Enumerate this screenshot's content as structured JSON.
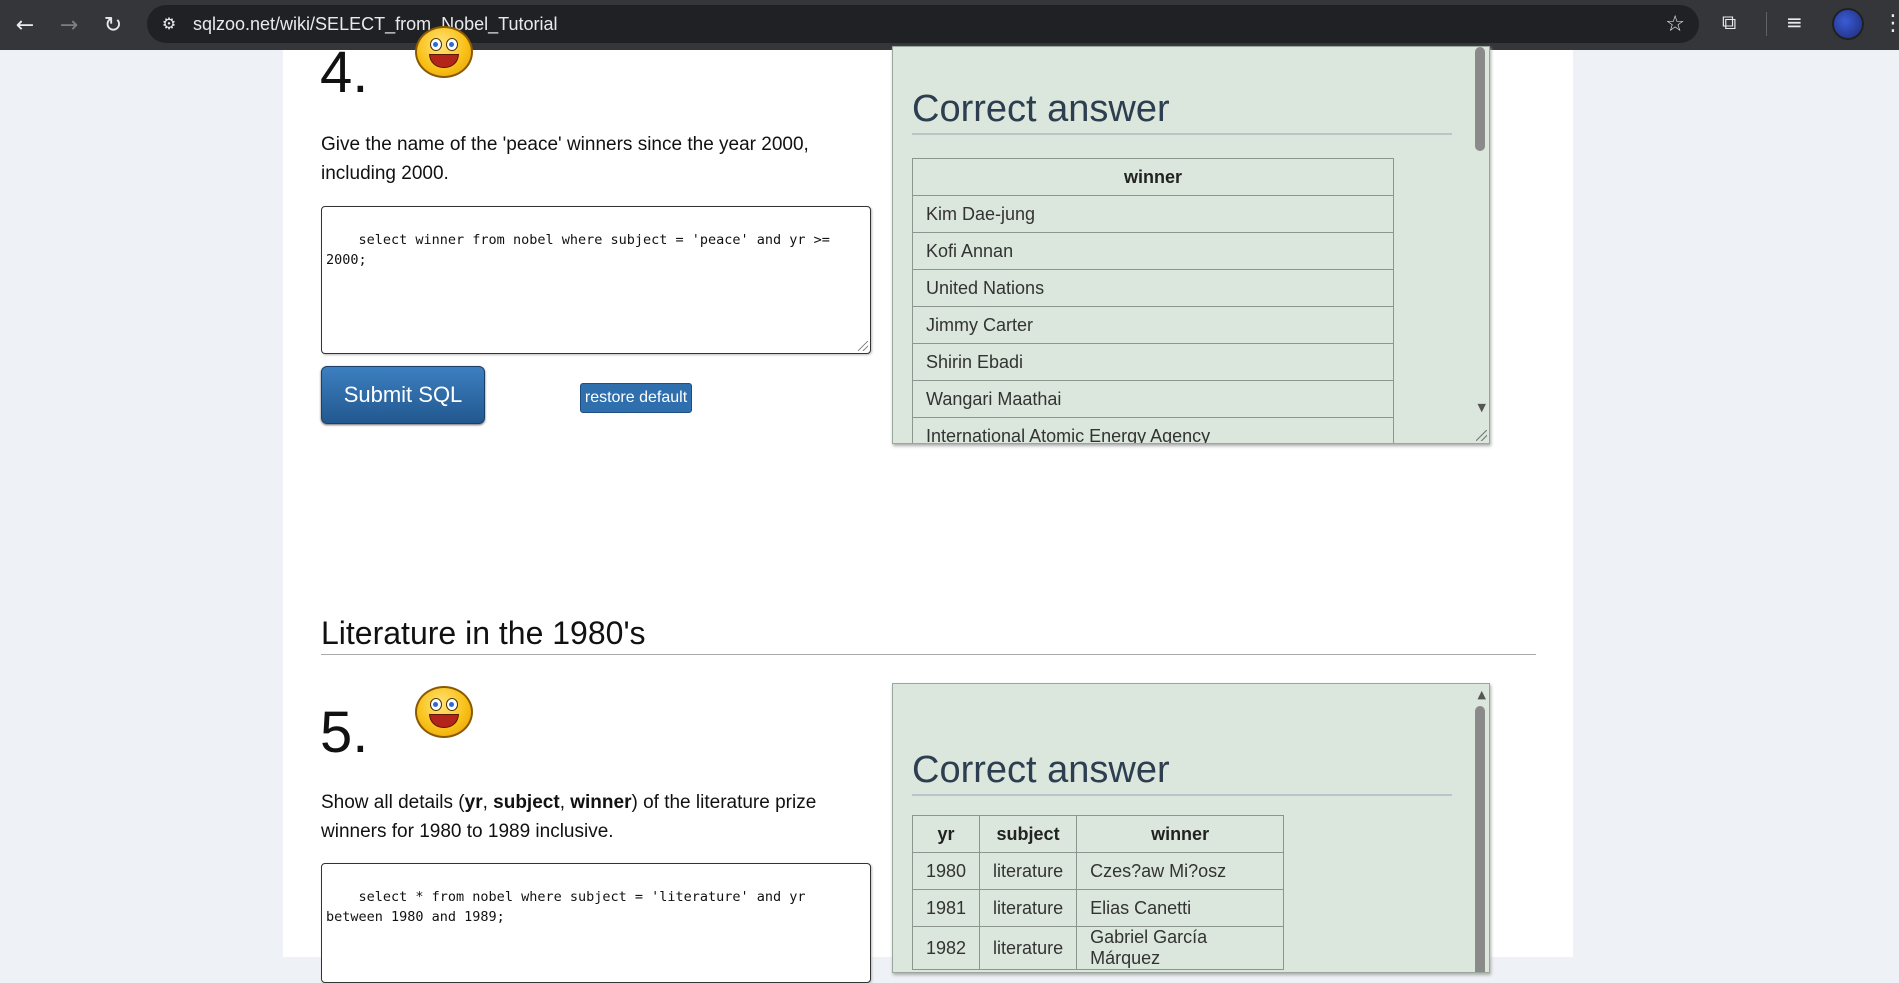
{
  "browser": {
    "url": "sqlzoo.net/wiki/SELECT_from_Nobel_Tutorial"
  },
  "q4": {
    "number": "4.",
    "prompt": "Give the name of the 'peace' winners since the year 2000, including 2000.",
    "sql": "select winner from nobel where subject = 'peace' and yr >= 2000;",
    "submit_label": "Submit SQL",
    "restore_label": "restore default",
    "answer": {
      "title": "Correct answer",
      "header": "winner",
      "rows": [
        "Kim Dae-jung",
        "Kofi Annan",
        "United Nations",
        "Jimmy Carter",
        "Shirin Ebadi",
        "Wangari Maathai",
        "International Atomic Energy Agency"
      ]
    }
  },
  "section": {
    "title": "Literature in the 1980's"
  },
  "q5": {
    "number": "5.",
    "prompt_pre": "Show all details (",
    "prompt_b1": "yr",
    "prompt_sep1": ", ",
    "prompt_b2": "subject",
    "prompt_sep2": ", ",
    "prompt_b3": "winner",
    "prompt_post": ") of the literature prize winners for 1980 to 1989 inclusive.",
    "sql": "select * from nobel where subject = 'literature' and yr\nbetween 1980 and 1989;",
    "answer": {
      "title": "Correct answer",
      "headers": [
        "yr",
        "subject",
        "winner"
      ],
      "rows": [
        [
          "1980",
          "literature",
          "Czes?aw Mi?osz"
        ],
        [
          "1981",
          "literature",
          "Elias Canetti"
        ],
        [
          "1982",
          "literature",
          "Gabriel García Márquez"
        ]
      ]
    }
  }
}
